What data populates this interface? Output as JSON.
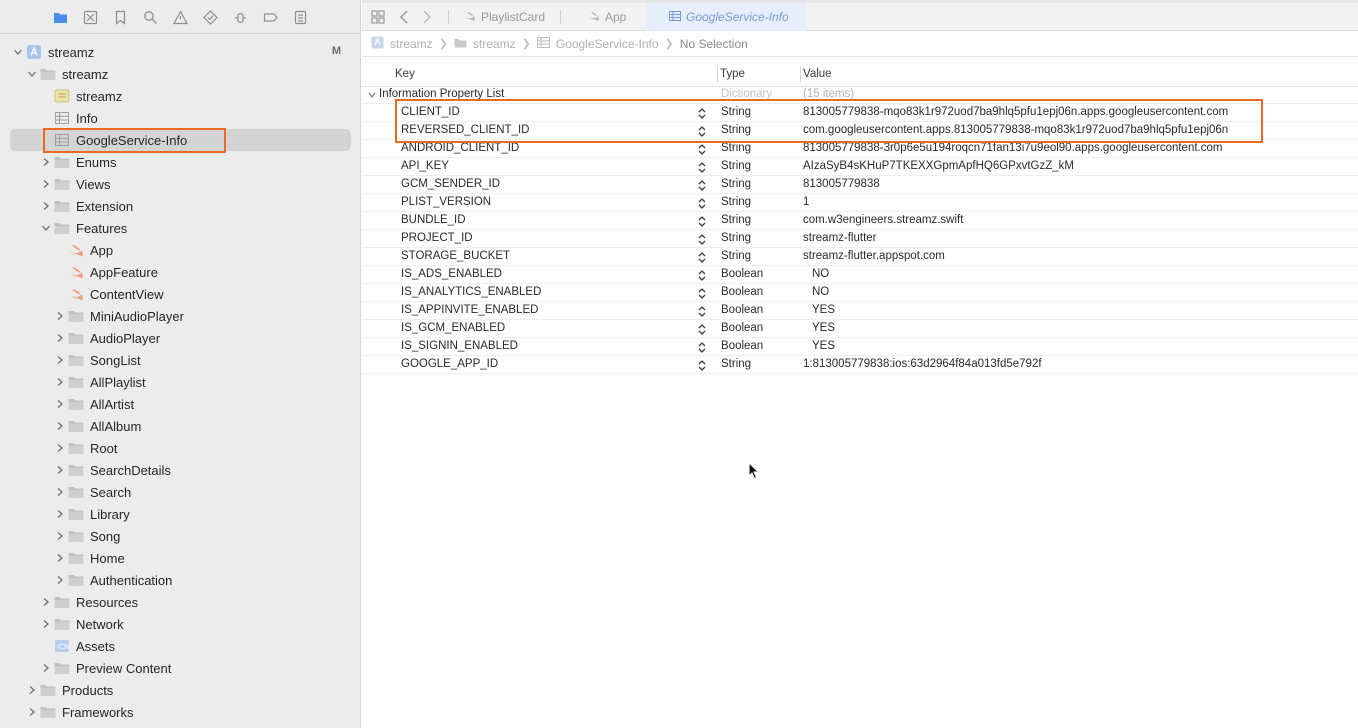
{
  "navigator": {
    "toolbar_icons": [
      "folder-icon",
      "source-control-icon",
      "bookmark-icon",
      "find-icon",
      "issue-icon",
      "test-icon",
      "debug-icon",
      "breakpoint-icon",
      "report-icon"
    ],
    "tree": [
      {
        "label": "streamz",
        "depth": 0,
        "expanded": true,
        "kind": "project",
        "badge": "M"
      },
      {
        "label": "streamz",
        "depth": 1,
        "expanded": true,
        "kind": "folder"
      },
      {
        "label": "streamz",
        "depth": 2,
        "kind": "entitlements"
      },
      {
        "label": "Info",
        "depth": 2,
        "kind": "plist"
      },
      {
        "label": "GoogleService-Info",
        "depth": 2,
        "kind": "plist",
        "selected": true
      },
      {
        "label": "Enums",
        "depth": 2,
        "expanded": false,
        "kind": "folder"
      },
      {
        "label": "Views",
        "depth": 2,
        "expanded": false,
        "kind": "folder"
      },
      {
        "label": "Extension",
        "depth": 2,
        "expanded": false,
        "kind": "folder"
      },
      {
        "label": "Features",
        "depth": 2,
        "expanded": true,
        "kind": "folder"
      },
      {
        "label": "App",
        "depth": 3,
        "kind": "swift"
      },
      {
        "label": "AppFeature",
        "depth": 3,
        "kind": "swift"
      },
      {
        "label": "ContentView",
        "depth": 3,
        "kind": "swift"
      },
      {
        "label": "MiniAudioPlayer",
        "depth": 3,
        "expanded": false,
        "kind": "folder"
      },
      {
        "label": "AudioPlayer",
        "depth": 3,
        "expanded": false,
        "kind": "folder"
      },
      {
        "label": "SongList",
        "depth": 3,
        "expanded": false,
        "kind": "folder"
      },
      {
        "label": "AllPlaylist",
        "depth": 3,
        "expanded": false,
        "kind": "folder"
      },
      {
        "label": "AllArtist",
        "depth": 3,
        "expanded": false,
        "kind": "folder"
      },
      {
        "label": "AllAlbum",
        "depth": 3,
        "expanded": false,
        "kind": "folder"
      },
      {
        "label": "Root",
        "depth": 3,
        "expanded": false,
        "kind": "folder"
      },
      {
        "label": "SearchDetails",
        "depth": 3,
        "expanded": false,
        "kind": "folder"
      },
      {
        "label": "Search",
        "depth": 3,
        "expanded": false,
        "kind": "folder"
      },
      {
        "label": "Library",
        "depth": 3,
        "expanded": false,
        "kind": "folder"
      },
      {
        "label": "Song",
        "depth": 3,
        "expanded": false,
        "kind": "folder"
      },
      {
        "label": "Home",
        "depth": 3,
        "expanded": false,
        "kind": "folder"
      },
      {
        "label": "Authentication",
        "depth": 3,
        "expanded": false,
        "kind": "folder"
      },
      {
        "label": "Resources",
        "depth": 2,
        "expanded": false,
        "kind": "folder"
      },
      {
        "label": "Network",
        "depth": 2,
        "expanded": false,
        "kind": "folder"
      },
      {
        "label": "Assets",
        "depth": 2,
        "kind": "assets"
      },
      {
        "label": "Preview Content",
        "depth": 2,
        "expanded": false,
        "kind": "folder"
      },
      {
        "label": "Products",
        "depth": 1,
        "expanded": false,
        "kind": "folder"
      },
      {
        "label": "Frameworks",
        "depth": 1,
        "expanded": false,
        "kind": "folder"
      }
    ]
  },
  "tabs": [
    {
      "label": "PlaylistCard",
      "icon": "swift-icon",
      "active": false
    },
    {
      "label": "App",
      "icon": "swift-icon",
      "active": false
    },
    {
      "label": "GoogleService-Info",
      "icon": "plist-icon",
      "active": true
    }
  ],
  "jumpbar": {
    "crumbs": [
      "streamz",
      "streamz",
      "GoogleService-Info"
    ],
    "last": "No Selection"
  },
  "plist": {
    "headers": {
      "key": "Key",
      "type": "Type",
      "value": "Value"
    },
    "root": {
      "key": "Information Property List",
      "type": "Dictionary",
      "value": "(15 items)"
    },
    "rows": [
      {
        "key": "CLIENT_ID",
        "type": "String",
        "value": "813005779838-mqo83k1r972uod7ba9hlq5pfu1epj06n.apps.googleusercontent.com"
      },
      {
        "key": "REVERSED_CLIENT_ID",
        "type": "String",
        "value": "com.googleusercontent.apps.813005779838-mqo83k1r972uod7ba9hlq5pfu1epj06n"
      },
      {
        "key": "ANDROID_CLIENT_ID",
        "type": "String",
        "value": "813005779838-3r0p6e5u194roqcn71fan13i7u9eol90.apps.googleusercontent.com"
      },
      {
        "key": "API_KEY",
        "type": "String",
        "value": "AIzaSyB4sKHuP7TKEXXGpmApfHQ6GPxvtGzZ_kM"
      },
      {
        "key": "GCM_SENDER_ID",
        "type": "String",
        "value": "813005779838"
      },
      {
        "key": "PLIST_VERSION",
        "type": "String",
        "value": "1"
      },
      {
        "key": "BUNDLE_ID",
        "type": "String",
        "value": "com.w3engineers.streamz.swift"
      },
      {
        "key": "PROJECT_ID",
        "type": "String",
        "value": "streamz-flutter"
      },
      {
        "key": "STORAGE_BUCKET",
        "type": "String",
        "value": "streamz-flutter.appspot.com"
      },
      {
        "key": "IS_ADS_ENABLED",
        "type": "Boolean",
        "value": "NO"
      },
      {
        "key": "IS_ANALYTICS_ENABLED",
        "type": "Boolean",
        "value": "NO"
      },
      {
        "key": "IS_APPINVITE_ENABLED",
        "type": "Boolean",
        "value": "YES"
      },
      {
        "key": "IS_GCM_ENABLED",
        "type": "Boolean",
        "value": "YES"
      },
      {
        "key": "IS_SIGNIN_ENABLED",
        "type": "Boolean",
        "value": "YES"
      },
      {
        "key": "GOOGLE_APP_ID",
        "type": "String",
        "value": "1:813005779838:ios:63d2964f84a013fd5e792f"
      }
    ]
  },
  "colors": {
    "highlight": "#ea6a22",
    "folder": "#b9b9bb",
    "swift": "#f09a7c",
    "accent": "#7a9ad0"
  }
}
